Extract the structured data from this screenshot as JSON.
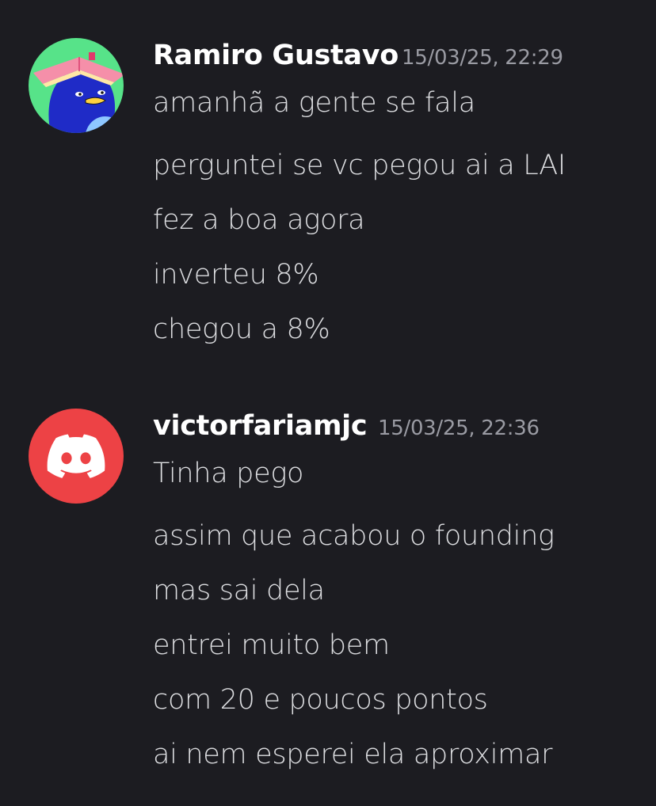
{
  "messages": [
    {
      "author": "Ramiro Gustavo",
      "timestamp": "15/03/25, 22:29",
      "avatar_icon": "penguin-book-avatar-icon",
      "lines": [
        "amanhã a gente se fala",
        "perguntei se vc pegou ai a LAI",
        "fez a boa agora",
        "inverteu 8%",
        "chegou a 8%"
      ]
    },
    {
      "author": "victorfariamjc",
      "timestamp": "15/03/25, 22:36",
      "avatar_icon": "discord-logo-icon",
      "lines": [
        "Tinha pego",
        "assim que acabou o founding",
        "mas sai dela",
        "entrei muito bem",
        "com 20 e poucos pontos",
        "ai nem esperei ela aproximar"
      ]
    }
  ],
  "colors": {
    "background": "#1c1c21",
    "username": "#ffffff",
    "message_text": "#dcdde0",
    "timestamp": "#9a9ba3",
    "discord_avatar_bg": "#ed4245",
    "penguin_avatar_bg": "#57e389"
  }
}
